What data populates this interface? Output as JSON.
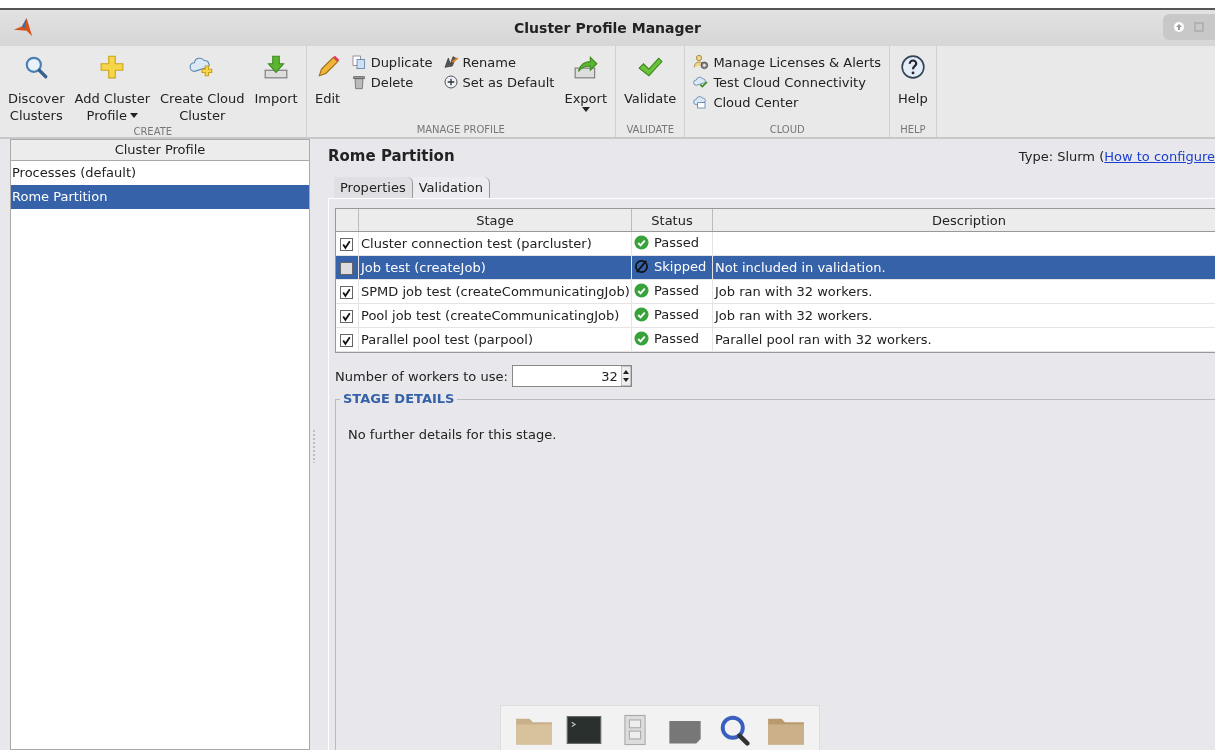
{
  "window": {
    "title": "Cluster Profile Manager"
  },
  "toolstrip": {
    "groups": [
      {
        "label": "CREATE",
        "columns": [
          {
            "kind": "large",
            "lines": [
              "Discover",
              "Clusters"
            ],
            "dropdown": false
          },
          {
            "kind": "large",
            "lines": [
              "Add Cluster",
              "Profile"
            ],
            "dropdown": true
          },
          {
            "kind": "large",
            "lines": [
              "Create Cloud",
              "Cluster"
            ],
            "dropdown": false
          },
          {
            "kind": "large",
            "lines": [
              "Import"
            ],
            "dropdown": false
          }
        ]
      },
      {
        "label": "MANAGE PROFILE",
        "columns": [
          {
            "kind": "large",
            "lines": [
              "Edit"
            ],
            "dropdown": false
          },
          {
            "kind": "stack",
            "items": [
              "Duplicate",
              "Delete"
            ]
          },
          {
            "kind": "stack",
            "items": [
              "Rename",
              "Set as Default"
            ]
          },
          {
            "kind": "large",
            "lines": [
              "Export"
            ],
            "dropdown": true
          }
        ]
      },
      {
        "label": "VALIDATE",
        "columns": [
          {
            "kind": "large",
            "lines": [
              "Validate"
            ],
            "dropdown": false
          }
        ]
      },
      {
        "label": "CLOUD",
        "columns": [
          {
            "kind": "stack",
            "items": [
              "Manage Licenses & Alerts",
              "Test Cloud Connectivity",
              "Cloud Center"
            ]
          }
        ]
      },
      {
        "label": "HELP",
        "columns": [
          {
            "kind": "large",
            "lines": [
              "Help"
            ],
            "dropdown": false
          }
        ]
      }
    ]
  },
  "profiles": {
    "header": "Cluster Profile",
    "items": [
      {
        "label": "Processes (default)",
        "selected": false
      },
      {
        "label": "Rome Partition",
        "selected": true
      }
    ]
  },
  "profile": {
    "name": "Rome Partition",
    "type_text": "Type: Slurm (",
    "type_link": "How to configure",
    "tabs": [
      {
        "label": "Properties",
        "selected": false
      },
      {
        "label": "Validation",
        "selected": true
      }
    ],
    "table": {
      "columns": [
        "Stage",
        "Status",
        "Description"
      ],
      "rows": [
        {
          "checked": true,
          "stage": "Cluster connection test (parcluster)",
          "status": {
            "kind": "passed",
            "text": "Passed"
          },
          "description": "",
          "selected": false
        },
        {
          "checked": false,
          "stage": "Job test (createJob)",
          "status": {
            "kind": "skipped",
            "text": "Skipped"
          },
          "description": "Not included in validation.",
          "selected": true
        },
        {
          "checked": true,
          "stage": "SPMD job test (createCommunicatingJob)",
          "status": {
            "kind": "passed",
            "text": "Passed"
          },
          "description": "Job ran with 32 workers.",
          "selected": false
        },
        {
          "checked": true,
          "stage": "Pool job test (createCommunicatingJob)",
          "status": {
            "kind": "passed",
            "text": "Passed"
          },
          "description": "Job ran with 32 workers.",
          "selected": false
        },
        {
          "checked": true,
          "stage": "Parallel pool test (parpool)",
          "status": {
            "kind": "passed",
            "text": "Passed"
          },
          "description": "Parallel pool ran with 32 workers.",
          "selected": false
        }
      ]
    },
    "workers": {
      "label": "Number of workers to use:",
      "value": "32"
    },
    "stage_details": {
      "heading": "STAGE DETAILS",
      "text": "No further details for this stage."
    }
  }
}
